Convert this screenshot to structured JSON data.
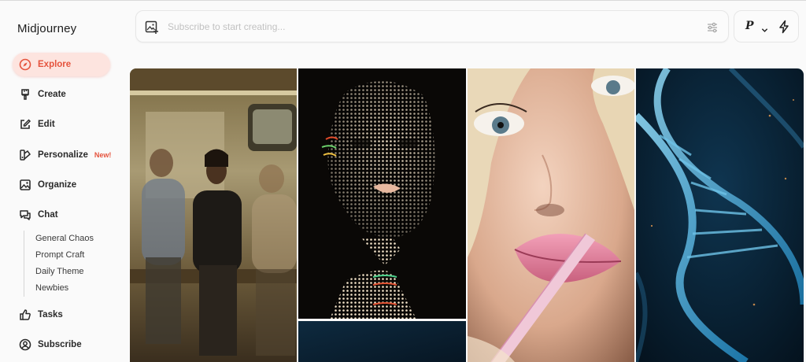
{
  "brand": {
    "name": "Midjourney"
  },
  "nav": {
    "items": [
      {
        "key": "explore",
        "label": "Explore",
        "icon": "compass-icon",
        "active": true
      },
      {
        "key": "create",
        "label": "Create",
        "icon": "brush-icon"
      },
      {
        "key": "edit",
        "label": "Edit",
        "icon": "edit-icon"
      },
      {
        "key": "personalize",
        "label": "Personalize",
        "icon": "palette-icon",
        "badge": "New!"
      },
      {
        "key": "organize",
        "label": "Organize",
        "icon": "image-icon"
      },
      {
        "key": "chat",
        "label": "Chat",
        "icon": "chat-icon"
      },
      {
        "key": "tasks",
        "label": "Tasks",
        "icon": "thumbs-up-icon"
      },
      {
        "key": "subscribe",
        "label": "Subscribe",
        "icon": "user-circle-icon"
      }
    ],
    "chat_channels": [
      "General Chaos",
      "Prompt Craft",
      "Daily Theme",
      "Newbies"
    ]
  },
  "search": {
    "placeholder": "Subscribe to start creating...",
    "value": ""
  },
  "mode": {
    "label": "P"
  },
  "colors": {
    "accent": "#e5533d",
    "active_bg": "#fde4df"
  },
  "gallery": {
    "tiles": [
      {
        "key": "subway",
        "icon": "photo-subway-passengers"
      },
      {
        "key": "dotface",
        "icon": "photo-dotted-light-face"
      },
      {
        "key": "blue",
        "icon": "photo-dark-blue"
      },
      {
        "key": "lips",
        "icon": "photo-glossy-lips"
      },
      {
        "key": "dna",
        "icon": "photo-dna-helix"
      }
    ]
  }
}
